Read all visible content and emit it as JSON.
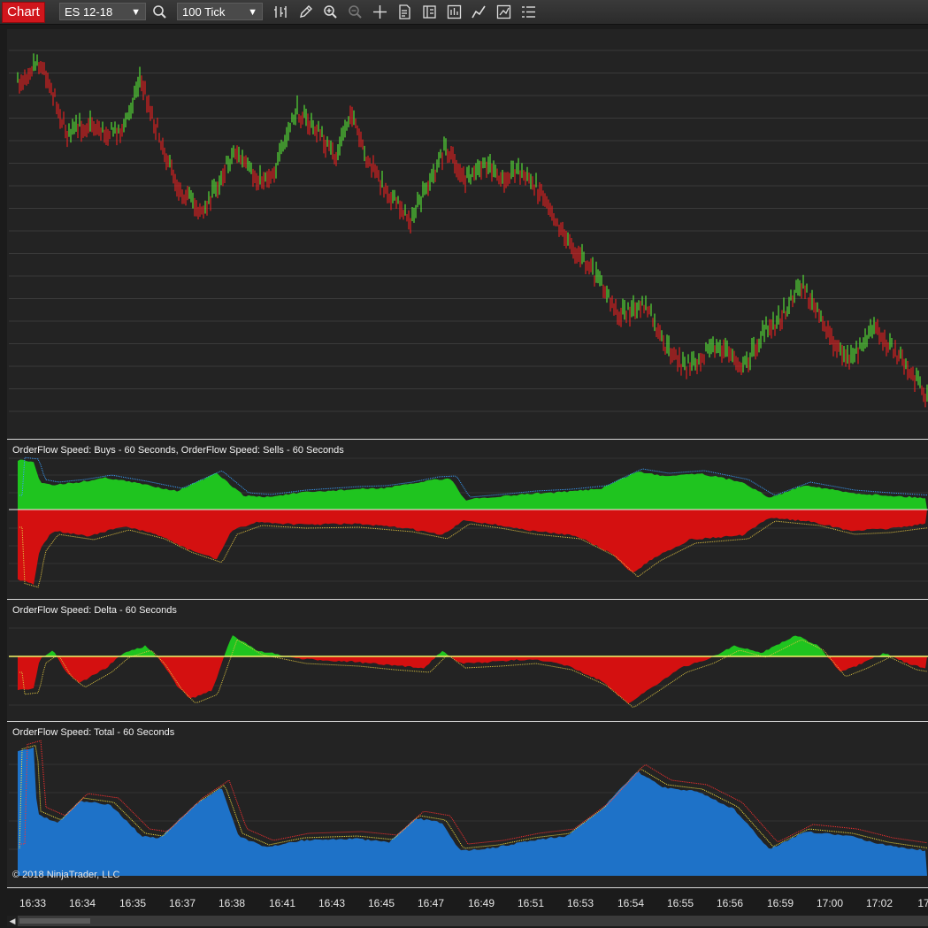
{
  "toolbar": {
    "chart_tab": "Chart",
    "instrument": "ES 12-18",
    "interval": "100 Tick",
    "icons": [
      "search-icon",
      "bar-type-icon",
      "pencil-icon",
      "zoom-in-icon",
      "zoom-out-icon",
      "crosshair-icon",
      "data-box-icon",
      "properties-icon",
      "indicators-icon",
      "strategies-icon",
      "drawing-objects-icon",
      "chart-trader-icon"
    ]
  },
  "panels": {
    "buys_sells_title": "OrderFlow Speed: Buys - 60 Seconds, OrderFlow Speed: Sells - 60 Seconds",
    "delta_title": "OrderFlow Speed: Delta - 60 Seconds",
    "total_title": "OrderFlow Speed: Total - 60 Seconds"
  },
  "copyright": "© 2018 NinjaTrader, LLC",
  "time_axis": [
    "16:33",
    "16:34",
    "16:35",
    "16:37",
    "16:38",
    "16:41",
    "16:43",
    "16:45",
    "16:47",
    "16:49",
    "16:51",
    "16:53",
    "16:54",
    "16:55",
    "16:56",
    "16:59",
    "17:00",
    "17:02",
    "17"
  ],
  "colors": {
    "up": "#5dff3a",
    "down": "#ff1f1f",
    "buys": "#1fc41f",
    "sells": "#d41010",
    "total": "#1e72c8",
    "zero_line": "#f5f56a"
  }
}
